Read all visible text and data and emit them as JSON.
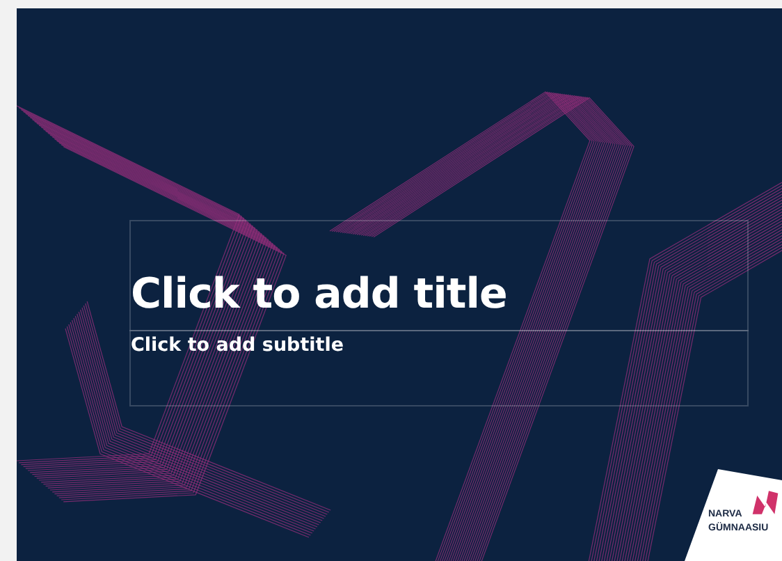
{
  "slide": {
    "title_placeholder": "Click to add title",
    "subtitle_placeholder": "Click to add subtitle",
    "logo": {
      "line_1": "NARVA",
      "line_2": "GÜMNAASIU"
    }
  }
}
